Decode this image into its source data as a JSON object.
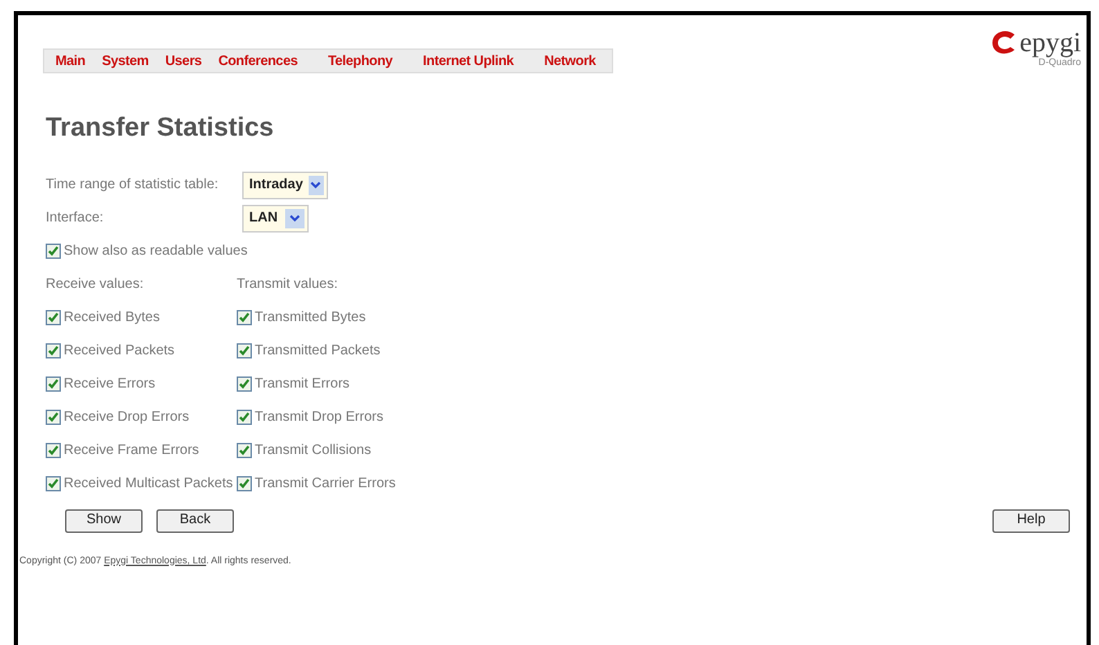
{
  "menu": [
    "Main",
    "System",
    "Users",
    "Conferences",
    "Telephony",
    "Internet Uplink",
    "Network"
  ],
  "logo": {
    "name": "epygi",
    "model": "D-Quadro"
  },
  "title": "Transfer Statistics",
  "fields": [
    {
      "label": "Time range of statistic table:",
      "value": "Intraday"
    },
    {
      "label": "Interface:",
      "value": "LAN"
    }
  ],
  "readable": {
    "label": "Show also as readable values",
    "checked": true
  },
  "receive": {
    "heading": "Receive values:",
    "items": [
      {
        "label": "Received Bytes",
        "checked": true
      },
      {
        "label": "Received Packets",
        "checked": true
      },
      {
        "label": "Receive Errors",
        "checked": true
      },
      {
        "label": "Receive Drop Errors",
        "checked": true
      },
      {
        "label": "Receive Frame Errors",
        "checked": true
      },
      {
        "label": "Received Multicast Packets",
        "checked": true
      }
    ]
  },
  "transmit": {
    "heading": "Transmit values:",
    "items": [
      {
        "label": "Transmitted Bytes",
        "checked": true
      },
      {
        "label": "Transmitted Packets",
        "checked": true
      },
      {
        "label": "Transmit Errors",
        "checked": true
      },
      {
        "label": "Transmit Drop Errors",
        "checked": true
      },
      {
        "label": "Transmit Collisions",
        "checked": true
      },
      {
        "label": "Transmit Carrier Errors",
        "checked": true
      }
    ]
  },
  "buttons": [
    "Show",
    "Back"
  ],
  "help": "Help",
  "copyright": {
    "before": "Copyright (C) 2007",
    "link": "Epygi Technologies, Ltd",
    "after": ". All rights reserved."
  }
}
